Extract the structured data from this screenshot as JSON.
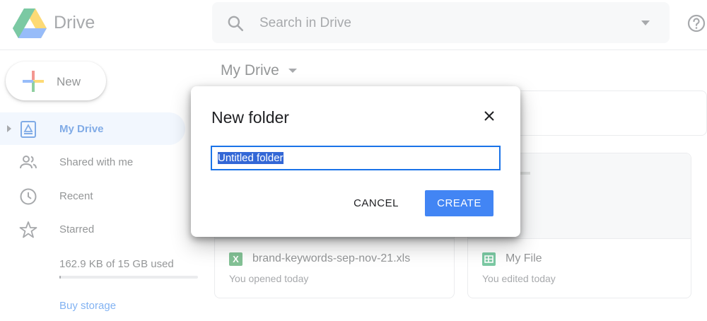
{
  "header": {
    "app_name": "Drive",
    "search_placeholder": "Search in Drive"
  },
  "sidebar": {
    "new_label": "New",
    "items": [
      {
        "label": "My Drive",
        "icon": "my-drive-icon",
        "active": true
      },
      {
        "label": "Shared with me",
        "icon": "people-icon",
        "active": false
      },
      {
        "label": "Recent",
        "icon": "clock-icon",
        "active": false
      },
      {
        "label": "Starred",
        "icon": "star-icon",
        "active": false
      }
    ],
    "storage_text": "162.9 KB of 15 GB used",
    "storage_used_fraction": 0.0,
    "buy_storage": "Buy storage"
  },
  "main": {
    "title": "My Drive",
    "files": [
      {
        "name": "brand-keywords-sep-nov-21.xls",
        "sub": "You opened today",
        "icon": "excel-icon",
        "icon_letter": "X",
        "color": "#1e8e3e"
      },
      {
        "name": "My File",
        "sub": "You edited today",
        "icon": "sheets-icon",
        "icon_letter": "",
        "color": "#0f9d58"
      }
    ]
  },
  "dialog": {
    "title": "New folder",
    "input_value": "Untitled folder",
    "cancel_label": "CANCEL",
    "create_label": "CREATE"
  },
  "colors": {
    "accent": "#1a73e8",
    "create_button": "#4285f4",
    "active_nav_bg": "#e8f0fe"
  }
}
